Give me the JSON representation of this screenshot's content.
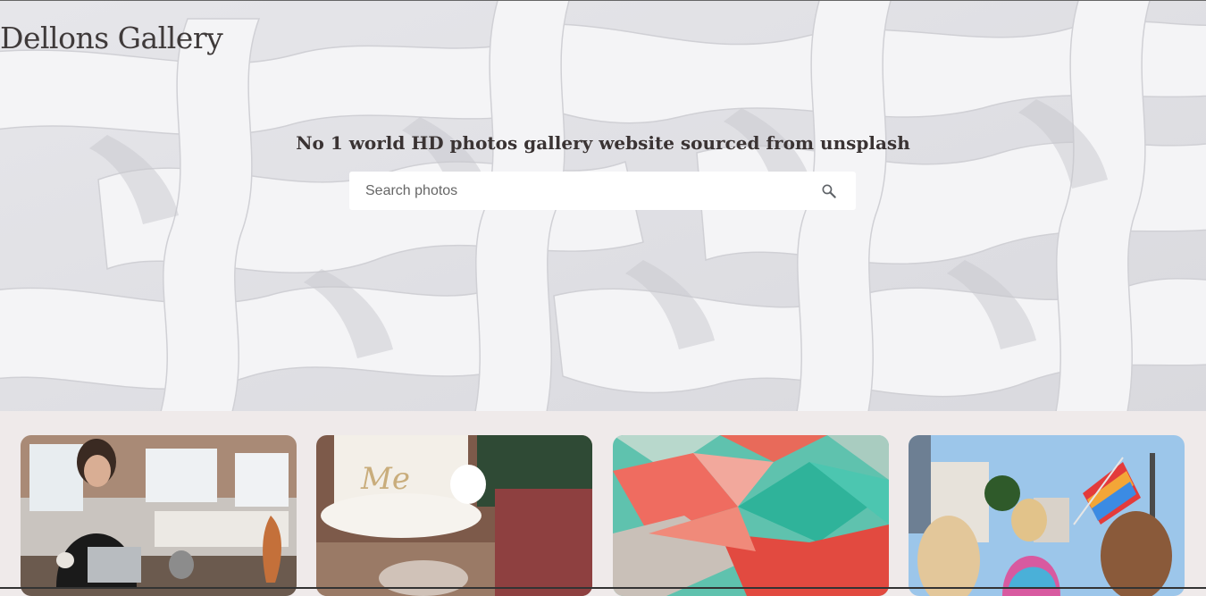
{
  "header": {
    "title": "Dellons Gallery"
  },
  "hero": {
    "tagline": "No 1 world HD photos gallery website sourced from unsplash",
    "background": "abstract-white-lattice"
  },
  "search": {
    "placeholder": "Search photos",
    "value": "",
    "icon": "search-icon"
  },
  "gallery": {
    "photos": [
      {
        "subject": "woman-laptop-kitchen"
      },
      {
        "subject": "white-cake-blurred"
      },
      {
        "subject": "red-teal-low-poly"
      },
      {
        "subject": "pride-parade-crowd"
      }
    ]
  },
  "colors": {
    "page_background": "#efeaea",
    "title_text": "#3f3a3a",
    "search_background": "#ffffff"
  }
}
